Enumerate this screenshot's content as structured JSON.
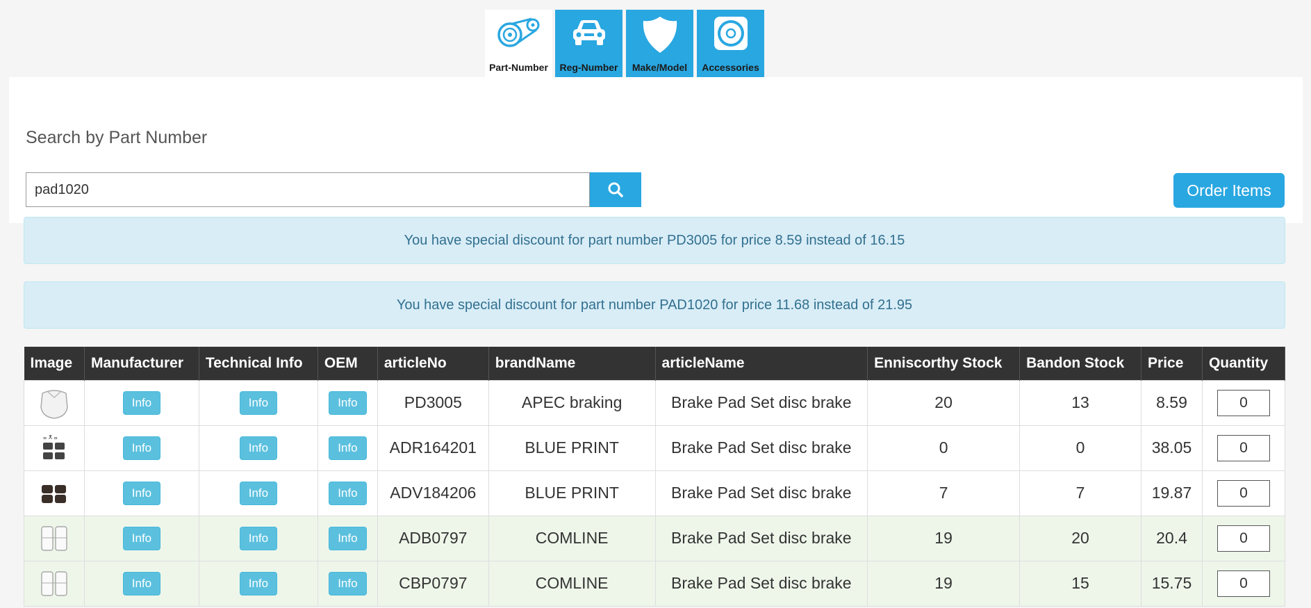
{
  "tabs": [
    {
      "label": "Part-Number",
      "icon": "timing-belt-icon",
      "active": true
    },
    {
      "label": "Reg-Number",
      "icon": "car-icon",
      "active": false
    },
    {
      "label": "Make/Model",
      "icon": "shield-icon",
      "active": false
    },
    {
      "label": "Accessories",
      "icon": "speaker-icon",
      "active": false
    }
  ],
  "search": {
    "title": "Search by Part Number",
    "value": "pad1020",
    "order_label": "Order Items"
  },
  "alerts": [
    "You have special discount for part number PD3005 for price 8.59 instead of 16.15",
    "You have special discount for part number PAD1020 for price 11.68 instead of 21.95"
  ],
  "table": {
    "headers": [
      "Image",
      "Manufacturer",
      "Technical Info",
      "OEM",
      "articleNo",
      "brandName",
      "articleName",
      "Enniscorthy Stock",
      "Bandon Stock",
      "Price",
      "Quantity"
    ],
    "info_label": "Info",
    "rows": [
      {
        "articleNo": "PD3005",
        "brandName": "APEC braking",
        "articleName": "Brake Pad Set disc brake",
        "enniscorthy": "20",
        "bandon": "13",
        "price": "8.59",
        "qty": "0",
        "highlight": false
      },
      {
        "articleNo": "ADR164201",
        "brandName": "BLUE PRINT",
        "articleName": "Brake Pad Set disc brake",
        "enniscorthy": "0",
        "bandon": "0",
        "price": "38.05",
        "qty": "0",
        "highlight": false
      },
      {
        "articleNo": "ADV184206",
        "brandName": "BLUE PRINT",
        "articleName": "Brake Pad Set disc brake",
        "enniscorthy": "7",
        "bandon": "7",
        "price": "19.87",
        "qty": "0",
        "highlight": false
      },
      {
        "articleNo": "ADB0797",
        "brandName": "COMLINE",
        "articleName": "Brake Pad Set disc brake",
        "enniscorthy": "19",
        "bandon": "20",
        "price": "20.4",
        "qty": "0",
        "highlight": true
      },
      {
        "articleNo": "CBP0797",
        "brandName": "COMLINE",
        "articleName": "Brake Pad Set disc brake",
        "enniscorthy": "19",
        "bandon": "15",
        "price": "15.75",
        "qty": "0",
        "highlight": true
      }
    ]
  },
  "colors": {
    "accent": "#29a7e1",
    "header_bg": "#333333",
    "alert_bg": "#d9edf7",
    "alert_text": "#31708f",
    "row_highlight": "#eef6ea"
  }
}
